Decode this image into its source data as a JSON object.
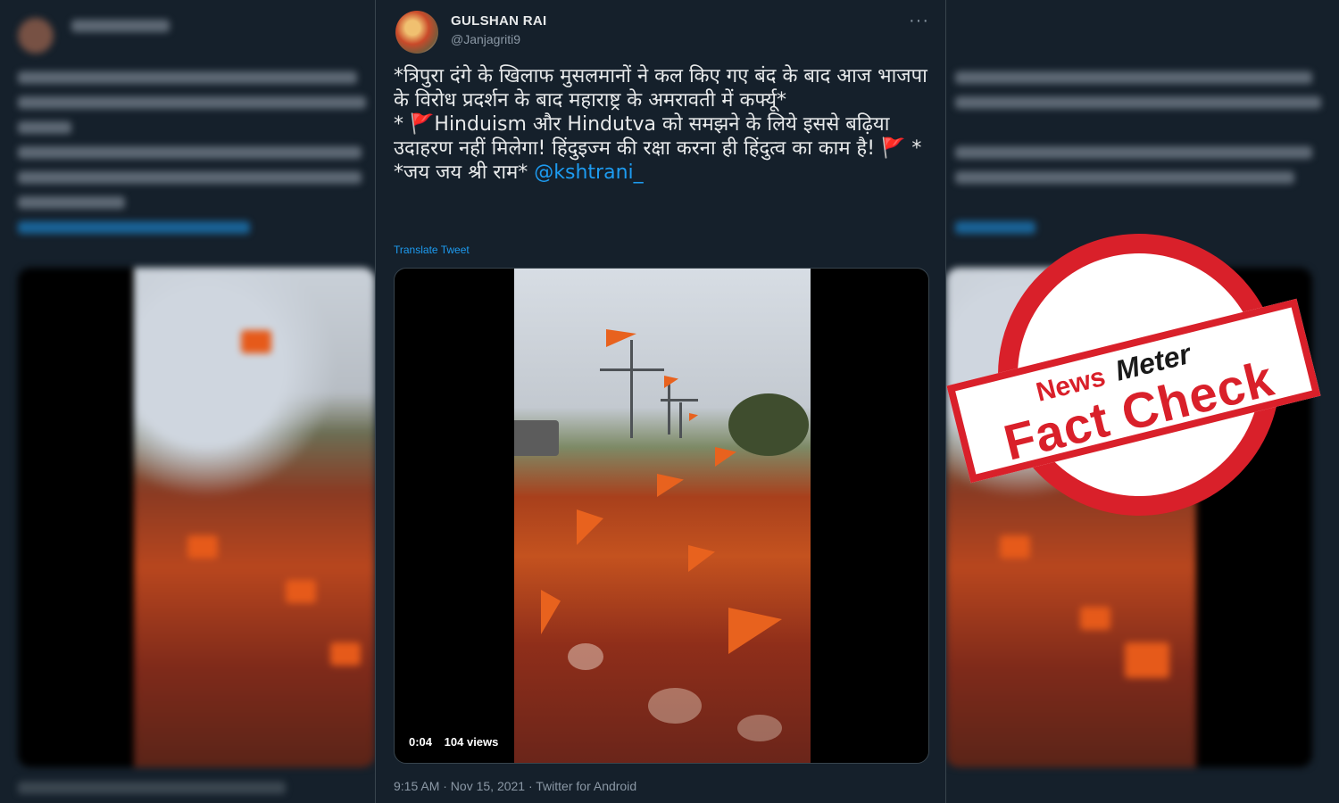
{
  "tweet": {
    "author_name": "GULSHAN RAI",
    "author_handle": "@Janjagriti9",
    "more_label": "···",
    "text_lines": [
      "*त्रिपुरा दंगे के खिलाफ मुसलमानों ने कल किए गए बंद के बाद आज भाजपा के विरोध प्रदर्शन के बाद महाराष्ट्र के अमरावती में कर्फ्यू*",
      "Hinduism और Hindutva को समझने के लिये इससे बढ़िया उदाहरण नहीं मिलेगा!   हिंदुइज्म की रक्षा करना ही हिंदुत्व का काम है!",
      "*जय जय श्री राम*"
    ],
    "line2_prefix": "* ",
    "line2_suffix": " *",
    "flag_glyph": "🚩",
    "mention": "@kshtrani_",
    "translate_label": "Translate Tweet",
    "video": {
      "elapsed": "0:04",
      "views": "104 views"
    },
    "timestamp": "9:15 AM · Nov 15, 2021 · Twitter for Android"
  },
  "stamp": {
    "brand_news": "News",
    "brand_meter": "Meter",
    "label": "Fact Check"
  },
  "colors": {
    "background": "#15202b",
    "accent_blue": "#1d9bf0",
    "stamp_red": "#d9202a",
    "flag_saffron": "#e8621e"
  }
}
